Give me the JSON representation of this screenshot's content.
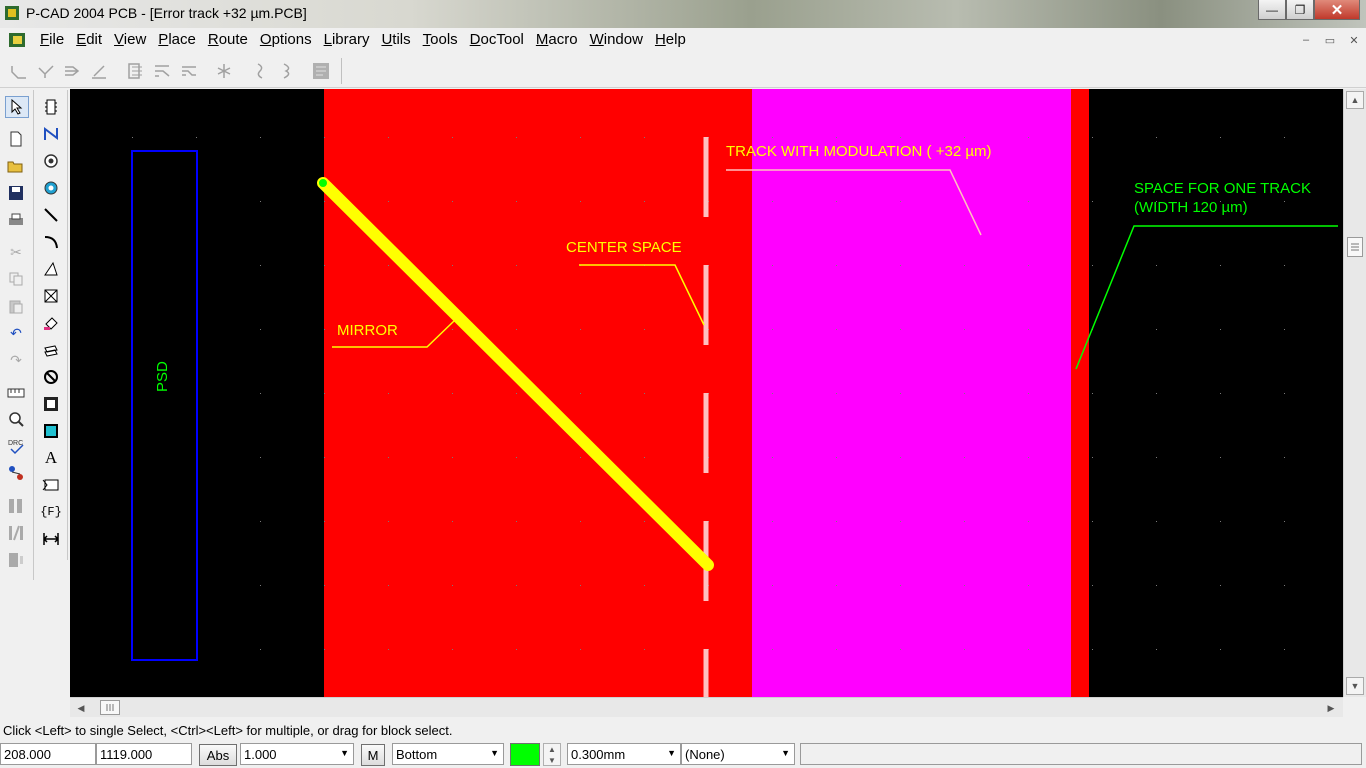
{
  "window": {
    "title": "P-CAD 2004 PCB - [Error track  +32 µm.PCB]",
    "minimize_glyph": "—",
    "maximize_glyph": "❐",
    "close_glyph": "✕"
  },
  "menubar": {
    "items": [
      "File",
      "Edit",
      "View",
      "Place",
      "Route",
      "Options",
      "Library",
      "Utils",
      "Tools",
      "DocTool",
      "Macro",
      "Window",
      "Help"
    ],
    "mdi_minimize": "–",
    "mdi_restore": "▭",
    "mdi_close": "✕"
  },
  "top_toolbar": {
    "icons": [
      "route-manual-icon",
      "route-interactive-icon",
      "route-multi-icon",
      "route-bus-icon",
      "route-fanout-icon",
      "route-tune-icon",
      "route-diffpair-icon",
      "route-miter-icon",
      "route-arc-icon",
      "route-arc2-icon",
      "route-report-icon"
    ]
  },
  "canvas": {
    "background": "#000000",
    "colors": {
      "board_red": "#ff0000",
      "magenta": "#ff00ff",
      "track_yellow": "#ffff00",
      "label_yellow": "#ffff00",
      "label_green": "#00ff00",
      "outline_blue": "#0000ff",
      "center_line": "#ffc0c0"
    },
    "labels": {
      "psd": "PSD",
      "mirror": "MIRROR",
      "center_space": "CENTER SPACE",
      "track_modulation": "TRACK WITH MODULATION ( +32 µm)",
      "space_one_track_1": "SPACE FOR ONE TRACK",
      "space_one_track_2": "(WIDTH 120 µm)"
    }
  },
  "status": {
    "prompt": "Click <Left> to single Select, <Ctrl><Left> for multiple, or drag for block select.",
    "x_coord": "208.000",
    "y_coord": "1119.000",
    "abs_label": "Abs",
    "grid_value": "1.000",
    "m_label": "M",
    "layer": "Bottom",
    "layer_color": "#00ff00",
    "line_width": "0.300mm",
    "net": "(None)"
  }
}
